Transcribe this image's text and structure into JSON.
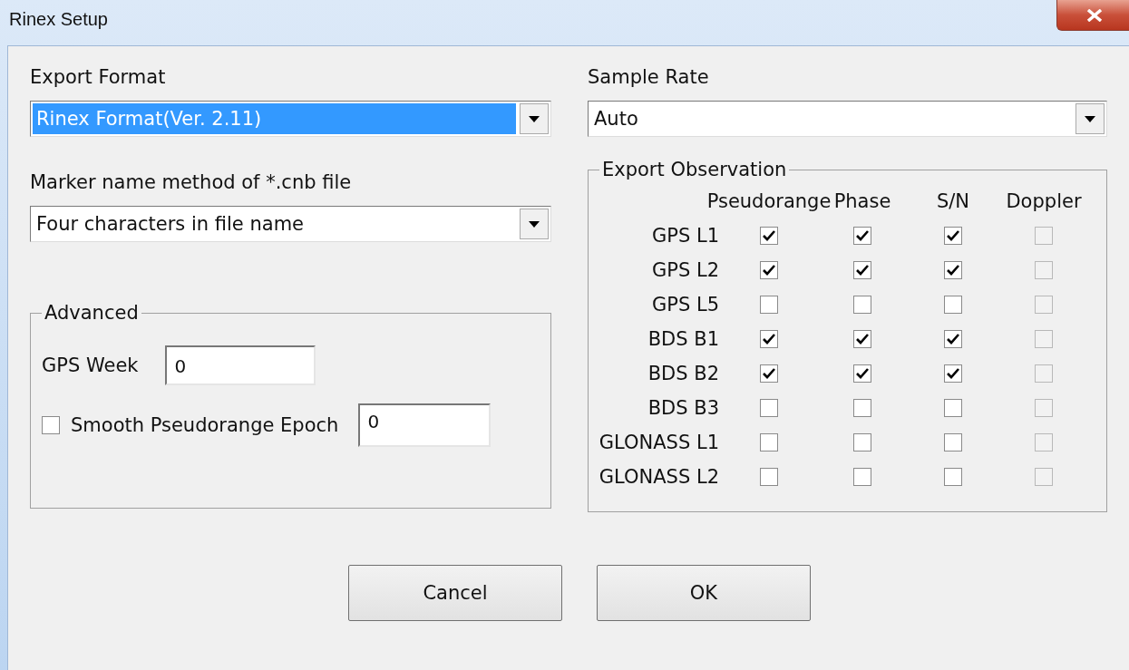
{
  "window": {
    "title": "Rinex Setup"
  },
  "export_format": {
    "label": "Export Format",
    "value": "Rinex Format(Ver. 2.11)",
    "highlighted": true
  },
  "marker_name": {
    "label": "Marker name method of *.cnb file",
    "value": "Four characters in file name",
    "highlighted": false
  },
  "advanced": {
    "title": "Advanced",
    "gps_week": {
      "label": "GPS Week",
      "value": "0"
    },
    "smooth": {
      "label": "Smooth Pseudorange Epoch",
      "checked": false,
      "value": "0"
    }
  },
  "sample_rate": {
    "label": "Sample Rate",
    "value": "Auto",
    "highlighted": false
  },
  "observation": {
    "title": "Export Observation",
    "columns": [
      "Pseudorange",
      "Phase",
      "S/N",
      "Doppler"
    ],
    "rows": [
      {
        "label": "GPS L1",
        "cells": [
          {
            "checked": true,
            "disabled": false
          },
          {
            "checked": true,
            "disabled": false
          },
          {
            "checked": true,
            "disabled": false
          },
          {
            "checked": false,
            "disabled": true
          }
        ]
      },
      {
        "label": "GPS L2",
        "cells": [
          {
            "checked": true,
            "disabled": false
          },
          {
            "checked": true,
            "disabled": false
          },
          {
            "checked": true,
            "disabled": false
          },
          {
            "checked": false,
            "disabled": true
          }
        ]
      },
      {
        "label": "GPS L5",
        "cells": [
          {
            "checked": false,
            "disabled": false
          },
          {
            "checked": false,
            "disabled": false
          },
          {
            "checked": false,
            "disabled": false
          },
          {
            "checked": false,
            "disabled": true
          }
        ]
      },
      {
        "label": "BDS B1",
        "cells": [
          {
            "checked": true,
            "disabled": false
          },
          {
            "checked": true,
            "disabled": false
          },
          {
            "checked": true,
            "disabled": false
          },
          {
            "checked": false,
            "disabled": true
          }
        ]
      },
      {
        "label": "BDS B2",
        "cells": [
          {
            "checked": true,
            "disabled": false
          },
          {
            "checked": true,
            "disabled": false
          },
          {
            "checked": true,
            "disabled": false
          },
          {
            "checked": false,
            "disabled": true
          }
        ]
      },
      {
        "label": "BDS B3",
        "cells": [
          {
            "checked": false,
            "disabled": false
          },
          {
            "checked": false,
            "disabled": false
          },
          {
            "checked": false,
            "disabled": false
          },
          {
            "checked": false,
            "disabled": true
          }
        ]
      },
      {
        "label": "GLONASS L1",
        "cells": [
          {
            "checked": false,
            "disabled": false
          },
          {
            "checked": false,
            "disabled": false
          },
          {
            "checked": false,
            "disabled": false
          },
          {
            "checked": false,
            "disabled": true
          }
        ]
      },
      {
        "label": "GLONASS L2",
        "cells": [
          {
            "checked": false,
            "disabled": false
          },
          {
            "checked": false,
            "disabled": false
          },
          {
            "checked": false,
            "disabled": false
          },
          {
            "checked": false,
            "disabled": true
          }
        ]
      }
    ]
  },
  "buttons": [
    "Cancel",
    "OK"
  ]
}
